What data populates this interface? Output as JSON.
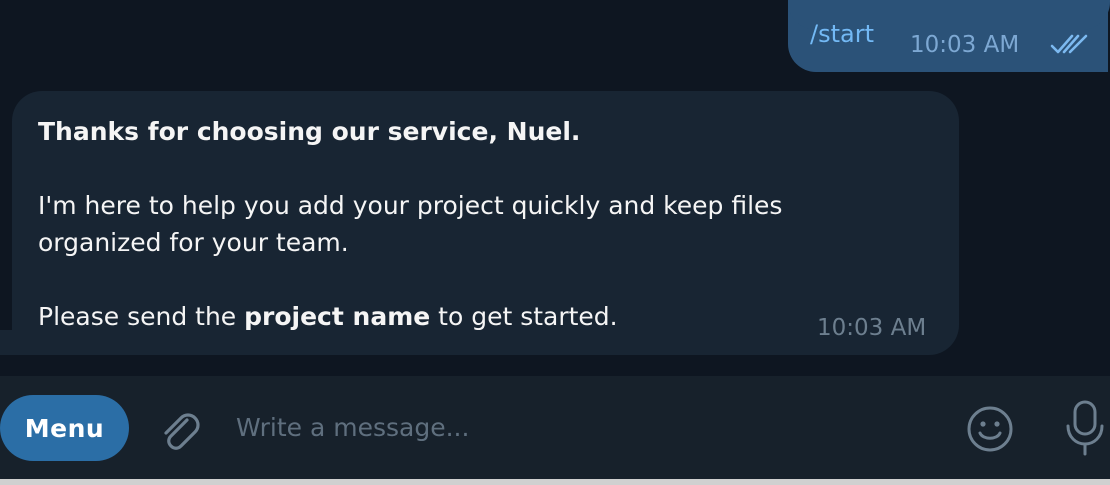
{
  "outgoing": {
    "text": "/start",
    "time": "10:03 AM",
    "status_icon": "double-check-icon"
  },
  "incoming": {
    "line1_bold": "Thanks for choosing our service, Nuel.",
    "para2": "I'm here to help you add your project quickly and keep files organized for your team.",
    "para3_before": "Please send the ",
    "para3_bold": "project name",
    "para3_after": " to get started.",
    "time": "10:03 AM"
  },
  "composer": {
    "menu_label": "Menu",
    "placeholder": "Write a message...",
    "attach_icon": "paperclip-icon",
    "emoji_icon": "smiley-icon",
    "mic_icon": "microphone-icon"
  },
  "colors": {
    "background": "#0e1621",
    "outgoing_bubble": "#2b5278",
    "incoming_bubble": "#182533",
    "composer": "#17212b",
    "accent": "#2b6ea6"
  }
}
